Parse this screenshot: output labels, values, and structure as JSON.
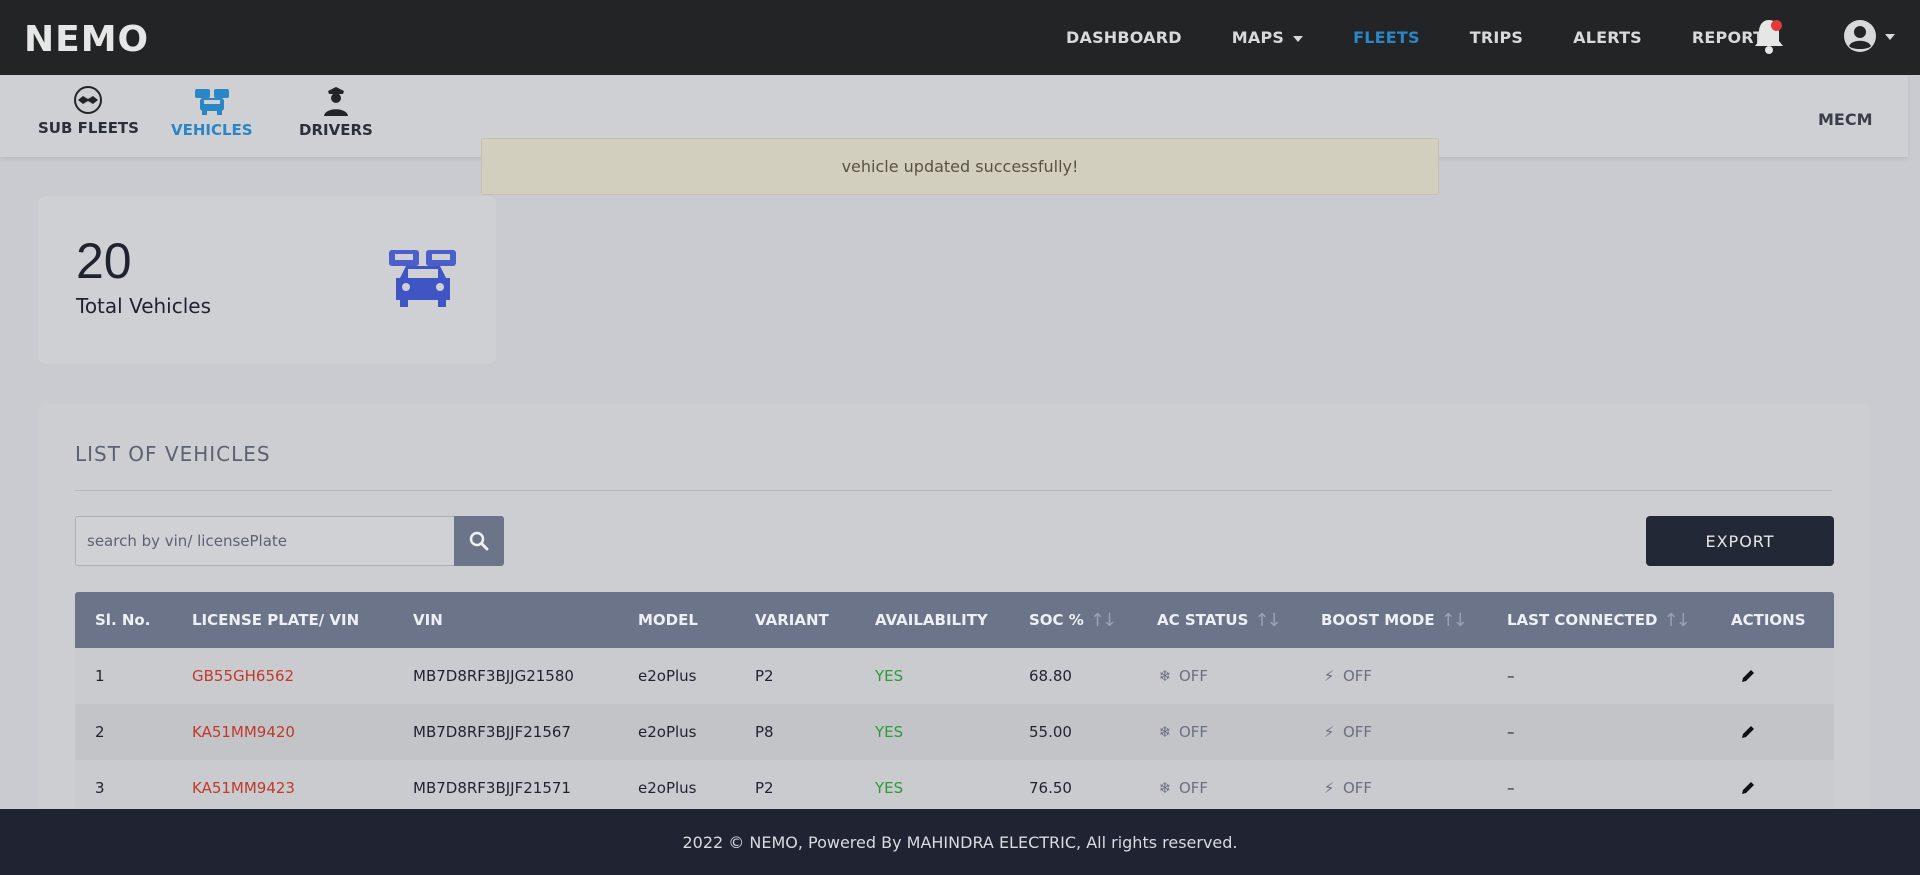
{
  "app": {
    "logo": "NEMO",
    "org": "MECM"
  },
  "nav": {
    "items": [
      {
        "label": "DASHBOARD",
        "active": false
      },
      {
        "label": "MAPS",
        "active": false,
        "dropdown": true
      },
      {
        "label": "FLEETS",
        "active": true
      },
      {
        "label": "TRIPS",
        "active": false
      },
      {
        "label": "ALERTS",
        "active": false
      },
      {
        "label": "REPORTS",
        "active": false
      }
    ]
  },
  "subnav": {
    "items": [
      {
        "label": "SUB FLEETS",
        "icon": "handshake-icon",
        "active": false
      },
      {
        "label": "VEHICLES",
        "icon": "cars-icon",
        "active": true
      },
      {
        "label": "DRIVERS",
        "icon": "driver-icon",
        "active": false
      }
    ]
  },
  "toast": {
    "message": "vehicle updated successfully!"
  },
  "stat": {
    "value": "20",
    "label": "Total Vehicles"
  },
  "list": {
    "title": "LIST OF VEHICLES",
    "search_placeholder": "search by vin/ licensePlate",
    "export_label": "EXPORT",
    "columns": [
      "Sl. No.",
      "LICENSE PLATE/ VIN",
      "VIN",
      "MODEL",
      "VARIANT",
      "AVAILABILITY",
      "SOC %",
      "AC STATUS",
      "BOOST MODE",
      "LAST CONNECTED",
      "ACTIONS"
    ],
    "rows": [
      {
        "sl": "1",
        "plate": "GB55GH6562",
        "vin": "MB7D8RF3BJJG21580",
        "model": "e2oPlus",
        "variant": "P2",
        "availability": "YES",
        "soc": "68.80",
        "ac": "OFF",
        "boost": "OFF",
        "last": "–"
      },
      {
        "sl": "2",
        "plate": "KA51MM9420",
        "vin": "MB7D8RF3BJJF21567",
        "model": "e2oPlus",
        "variant": "P8",
        "availability": "YES",
        "soc": "55.00",
        "ac": "OFF",
        "boost": "OFF",
        "last": "–"
      },
      {
        "sl": "3",
        "plate": "KA51MM9423",
        "vin": "MB7D8RF3BJJF21571",
        "model": "e2oPlus",
        "variant": "P2",
        "availability": "YES",
        "soc": "76.50",
        "ac": "OFF",
        "boost": "OFF",
        "last": "–"
      }
    ]
  },
  "footer": {
    "text": "2022 © NEMO, Powered By MAHINDRA ELECTRIC, All rights reserved."
  },
  "colors": {
    "active_nav": "#2b86c5",
    "plate": "#c0392b",
    "yes": "#2e9a3a",
    "header_bg": "#232426",
    "footer_bg": "#202331"
  }
}
